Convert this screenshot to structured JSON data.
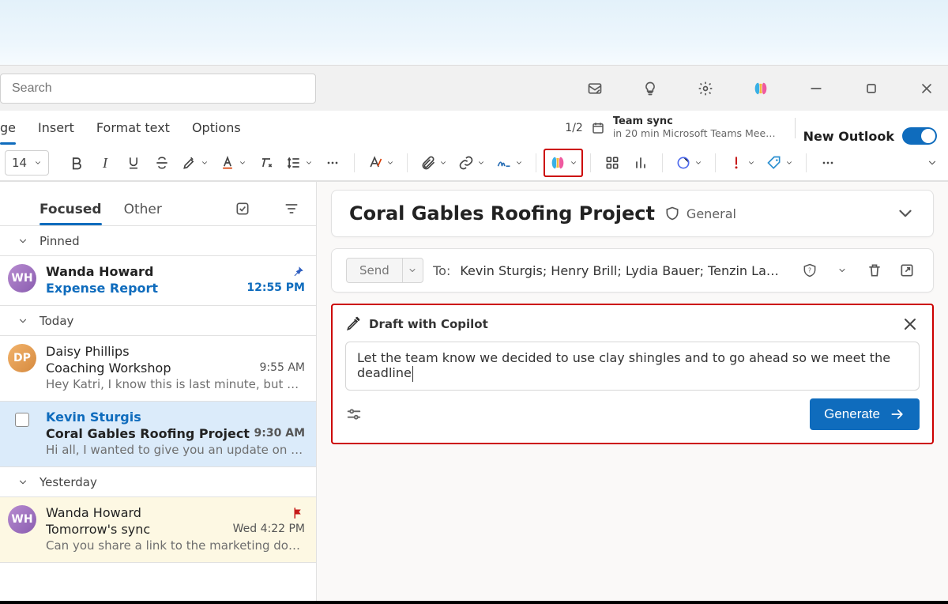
{
  "search": {
    "placeholder": "Search"
  },
  "titlebar": {
    "copilot_name": "copilot"
  },
  "tabs": {
    "message": "ge",
    "insert": "Insert",
    "format": "Format text",
    "options": "Options"
  },
  "meeting": {
    "count": "1/2",
    "title": "Team sync",
    "sub": "in 20 min Microsoft Teams Mee…"
  },
  "newOutlook": {
    "label": "New Outlook"
  },
  "toolbar": {
    "fontSize": "14"
  },
  "listHeader": {
    "focused": "Focused",
    "other": "Other"
  },
  "groups": {
    "pinned": "Pinned",
    "today": "Today",
    "yesterday": "Yesterday"
  },
  "messages": {
    "pinned": {
      "sender": "Wanda Howard",
      "subject": "Expense Report",
      "time": "12:55 PM"
    },
    "today": [
      {
        "sender": "Daisy Phillips",
        "subject": "Coaching Workshop",
        "time": "9:55 AM",
        "preview": "Hey Katri, I know this is last minute, but d…"
      },
      {
        "sender": "Kevin Sturgis",
        "subject": "Coral Gables Roofing Project",
        "time": "9:30 AM",
        "preview": "Hi all, I wanted to give you an update on t…"
      }
    ],
    "yesterday": {
      "sender": "Wanda Howard",
      "subject": "Tomorrow's sync",
      "time": "Wed 4:22 PM",
      "preview": "Can you share a link to the marketing doc…"
    }
  },
  "conversation": {
    "title": "Coral Gables Roofing Project",
    "label": "General"
  },
  "compose": {
    "send": "Send",
    "toLabel": "To:",
    "toList": "Kevin Sturgis; Henry Brill; Lydia Bauer; Tenzin Lasya"
  },
  "copilot": {
    "title": "Draft with Copilot",
    "input": "Let the team know we decided to use clay shingles and to go ahead so we meet the deadline",
    "generate": "Generate"
  }
}
